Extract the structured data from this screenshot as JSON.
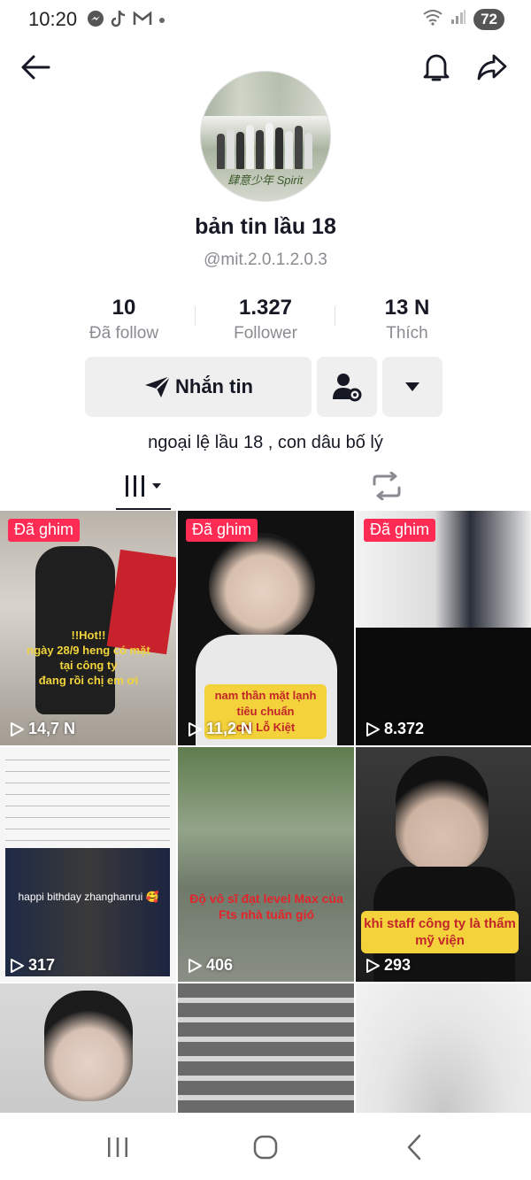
{
  "status_bar": {
    "time": "10:20",
    "battery": "72",
    "notification_icons": [
      "messenger-icon",
      "tiktok-icon",
      "gmail-icon",
      "dot-icon"
    ]
  },
  "profile": {
    "display_name": "bản tin lầu 18",
    "username": "@mit.2.0.1.2.0.3",
    "avatar_caption": "肆意少年 Spirit",
    "bio": "ngoại lệ lầu 18 , con dâu bố lý"
  },
  "stats": [
    {
      "value": "10",
      "label": "Đã follow"
    },
    {
      "value": "1.327",
      "label": "Follower"
    },
    {
      "value": "13 N",
      "label": "Thích"
    }
  ],
  "actions": {
    "message_label": "Nhắn tin"
  },
  "videos": [
    {
      "pinned": true,
      "pin_label": "Đã ghim",
      "views": "14,7 N",
      "overlay": "!!Hot!!\nngày 28/9 heng có mặt tại công ty\nđang rồi chị em ơi",
      "background": "#c9c4bb"
    },
    {
      "pinned": true,
      "pin_label": "Đã ghim",
      "views": "11,2 N",
      "overlay": "nam thần mặt lạnh tiêu chuẩn\nchỉ Lỗ Kiệt",
      "background": "#1a1a1a"
    },
    {
      "pinned": true,
      "pin_label": "Đã ghim",
      "views": "8.372",
      "overlay": "",
      "background": "#0d0d0d"
    },
    {
      "pinned": false,
      "pin_label": "",
      "views": "317",
      "overlay": "happi bithday zhanghanrui 🥰",
      "background": "#f4f4f4"
    },
    {
      "pinned": false,
      "pin_label": "",
      "views": "406",
      "overlay": "Độ vô sĩ đạt level Max của Fts nhà tuấn gió",
      "background": "#6f7a6a"
    },
    {
      "pinned": false,
      "pin_label": "",
      "views": "293",
      "overlay": "khi staff công ty là thẩm mỹ viện",
      "background": "#2a2a2a"
    },
    {
      "pinned": false,
      "pin_label": "",
      "views": "",
      "overlay": "",
      "background": "#cfcfcf"
    },
    {
      "pinned": false,
      "pin_label": "",
      "views": "",
      "overlay": "",
      "background": "#5a5a5a"
    },
    {
      "pinned": false,
      "pin_label": "",
      "views": "",
      "overlay": "",
      "background": "#e8e8e8"
    }
  ],
  "colors": {
    "accent": "#fe2c55",
    "caption_yellow": "#f4d23b",
    "caption_red": "#c2252a",
    "button_bg": "#efeff0",
    "muted_text": "#8a8b91"
  }
}
